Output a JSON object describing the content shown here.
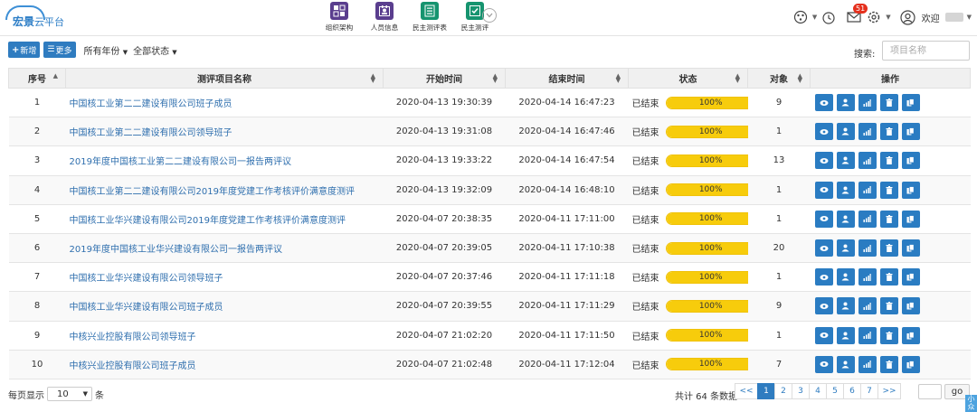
{
  "app": {
    "logo_main": "宏景",
    "logo_sub": "云平台"
  },
  "topnav": [
    {
      "label": "组织架构",
      "icon": "org-chart-icon",
      "color": "#5a3e8e"
    },
    {
      "label": "人员信息",
      "icon": "person-info-icon",
      "color": "#5a3e8e"
    },
    {
      "label": "民主测评表",
      "icon": "form-icon",
      "color": "#16946f"
    },
    {
      "label": "民主测评",
      "icon": "evaluation-icon",
      "color": "#16946f"
    }
  ],
  "header": {
    "mail_badge": "51",
    "welcome": "欢迎"
  },
  "toolbar": {
    "new_label": "新增",
    "more_label": "更多",
    "year_filter": "所有年份",
    "status_filter": "全部状态",
    "search_label": "搜索:",
    "search_placeholder": "项目名称"
  },
  "table": {
    "columns": [
      "序号",
      "测评项目名称",
      "开始时间",
      "结束时间",
      "状态",
      "对象",
      "操作"
    ],
    "rows": [
      {
        "no": "1",
        "name": "中国核工业第二二建设有限公司班子成员",
        "start": "2020-04-13 19:30:39",
        "end": "2020-04-14 16:47:23",
        "status": "已结束",
        "progress": 100,
        "progress_label": "100%",
        "count": "9"
      },
      {
        "no": "2",
        "name": "中国核工业第二二建设有限公司领导班子",
        "start": "2020-04-13 19:31:08",
        "end": "2020-04-14 16:47:46",
        "status": "已结束",
        "progress": 100,
        "progress_label": "100%",
        "count": "1"
      },
      {
        "no": "3",
        "name": "2019年度中国核工业第二二建设有限公司一报告两评议",
        "start": "2020-04-13 19:33:22",
        "end": "2020-04-14 16:47:54",
        "status": "已结束",
        "progress": 100,
        "progress_label": "100%",
        "count": "13"
      },
      {
        "no": "4",
        "name": "中国核工业第二二建设有限公司2019年度党建工作考核评价满意度测评",
        "start": "2020-04-13 19:32:09",
        "end": "2020-04-14 16:48:10",
        "status": "已结束",
        "progress": 100,
        "progress_label": "100%",
        "count": "1"
      },
      {
        "no": "5",
        "name": "中国核工业华兴建设有限公司2019年度党建工作考核评价满意度测评",
        "start": "2020-04-07 20:38:35",
        "end": "2020-04-11 17:11:00",
        "status": "已结束",
        "progress": 100,
        "progress_label": "100%",
        "count": "1"
      },
      {
        "no": "6",
        "name": "2019年度中国核工业华兴建设有限公司一报告两评议",
        "start": "2020-04-07 20:39:05",
        "end": "2020-04-11 17:10:38",
        "status": "已结束",
        "progress": 100,
        "progress_label": "100%",
        "count": "20"
      },
      {
        "no": "7",
        "name": "中国核工业华兴建设有限公司领导班子",
        "start": "2020-04-07 20:37:46",
        "end": "2020-04-11 17:11:18",
        "status": "已结束",
        "progress": 100,
        "progress_label": "100%",
        "count": "1"
      },
      {
        "no": "8",
        "name": "中国核工业华兴建设有限公司班子成员",
        "start": "2020-04-07 20:39:55",
        "end": "2020-04-11 17:11:29",
        "status": "已结束",
        "progress": 100,
        "progress_label": "100%",
        "count": "9"
      },
      {
        "no": "9",
        "name": "中核兴业控股有限公司领导班子",
        "start": "2020-04-07 21:02:20",
        "end": "2020-04-11 17:11:50",
        "status": "已结束",
        "progress": 100,
        "progress_label": "100%",
        "count": "1"
      },
      {
        "no": "10",
        "name": "中核兴业控股有限公司班子成员",
        "start": "2020-04-07 21:02:48",
        "end": "2020-04-11 17:12:04",
        "status": "已结束",
        "progress": 100,
        "progress_label": "100%",
        "count": "7"
      }
    ],
    "row_actions": [
      "view-icon",
      "user-assign-icon",
      "stats-icon",
      "delete-icon",
      "copy-icon"
    ]
  },
  "footer": {
    "per_page_prefix": "每页显示",
    "per_page_value": "10",
    "per_page_suffix": "条",
    "total": "共计 64 条数据",
    "pages": [
      "<<",
      "1",
      "2",
      "3",
      "4",
      "5",
      "6",
      "7",
      ">>"
    ],
    "active_page": "1",
    "go_label": "go",
    "corner_text": "小众"
  },
  "colors": {
    "accent": "#2f7cc0",
    "progress": "#f7cc0c",
    "link": "#2f6fae"
  }
}
